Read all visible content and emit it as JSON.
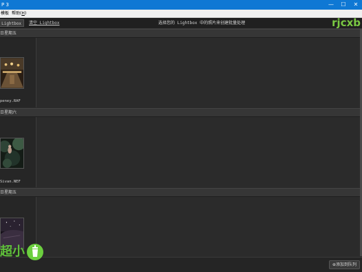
{
  "window": {
    "title": "P 3",
    "buttons": [
      "—",
      "☐",
      "✕"
    ]
  },
  "menubar": {
    "items": [
      {
        "prefix": "",
        "label": "模板"
      },
      {
        "prefix": "帮助(",
        "hotkey": "H",
        "suffix": ")"
      }
    ]
  },
  "toolbar": {
    "tab_label": "Lightbox",
    "clear_label": "清空 Lightbox",
    "hint": "选择您的 Lightbox 中的照片来创建批量处理",
    "brand": "rjcxb"
  },
  "groups": [
    {
      "header": "日星期五",
      "filename": "peney.RAF",
      "thumb_colors": [
        "#4a3a28",
        "#c8a468",
        "#2a1e14"
      ]
    },
    {
      "header": "日星期六",
      "filename": "Sivan.NEF",
      "thumb_colors": [
        "#1e2a22",
        "#3d5a44",
        "#141c16"
      ]
    },
    {
      "header": "日星期五",
      "filename": "",
      "thumb_colors": [
        "#2a2230",
        "#5a4a5e",
        "#141018"
      ]
    }
  ],
  "bottombar": {
    "queue_icon": "plus-circle-icon",
    "queue_label": "⊕添加到队列"
  },
  "watermark": {
    "text": "超小",
    "color": "#5fbf3a"
  }
}
